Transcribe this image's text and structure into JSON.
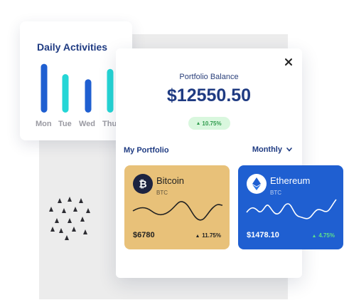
{
  "daily_activities": {
    "title": "Daily Activities",
    "days": [
      {
        "label": "Mon",
        "level": 0.95,
        "color": "#1f5fd1"
      },
      {
        "label": "Tue",
        "level": 0.75,
        "color": "#25d6d6"
      },
      {
        "label": "Wed",
        "level": 0.65,
        "color": "#1f5fd1"
      },
      {
        "label": "Thu",
        "level": 0.85,
        "color": "#25d6d6"
      }
    ]
  },
  "portfolio": {
    "balance_title": "Portfolio Balance",
    "balance_value": "$12550.50",
    "balance_change": "10.75%",
    "section_title": "My Portfolio",
    "period": "Monthly"
  },
  "coins": [
    {
      "name": "Bitcoin",
      "symbol": "BTC",
      "value": "$6780",
      "change": "11.75%",
      "icon": "bitcoin-icon",
      "color": "#e8c179",
      "change_color": "#222222"
    },
    {
      "name": "Ethereum",
      "symbol": "BTC",
      "value": "$1478.10",
      "change": "4.75%",
      "icon": "ethereum-icon",
      "color": "#1f5fd1",
      "change_color": "#5ee08a"
    }
  ],
  "colors": {
    "accent": "#1f3b82",
    "positive": "#2e9b4c"
  }
}
